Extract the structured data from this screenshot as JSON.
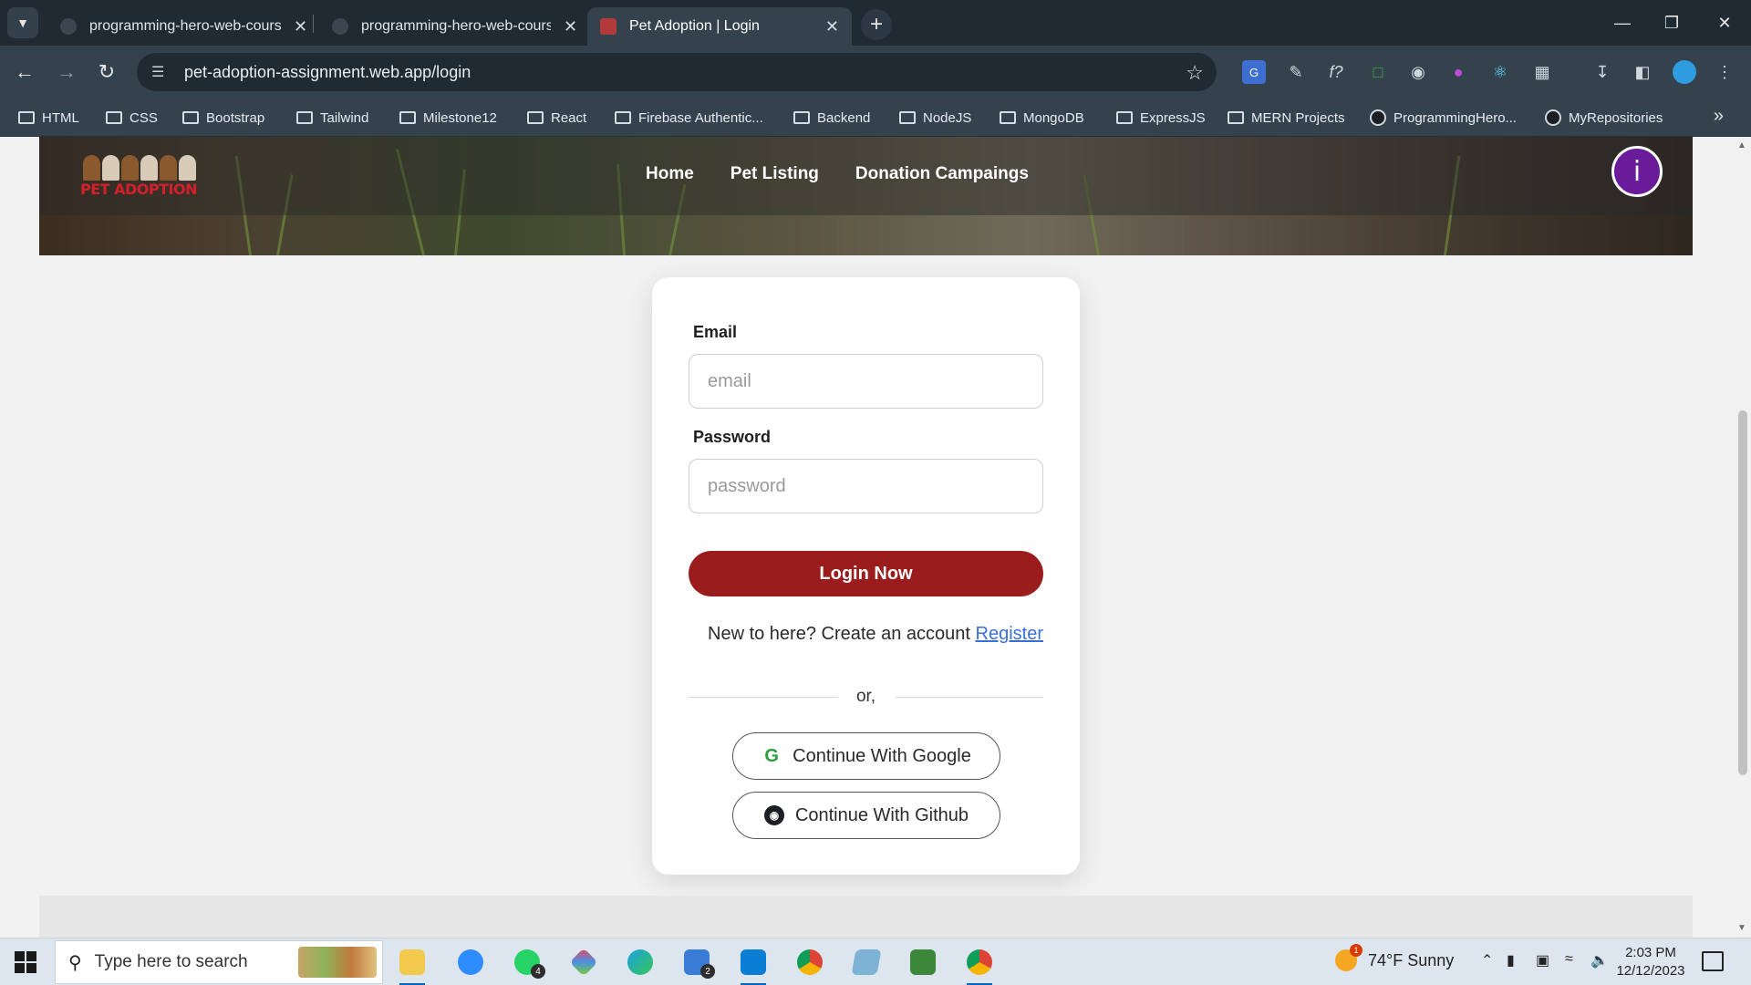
{
  "browser": {
    "tabs": [
      {
        "title": "programming-hero-web-course",
        "active": false
      },
      {
        "title": "programming-hero-web-course",
        "active": false
      },
      {
        "title": "Pet Adoption | Login",
        "active": true
      }
    ],
    "url": "pet-adoption-assignment.web.app/login",
    "bookmarks": [
      {
        "label": "HTML",
        "type": "folder"
      },
      {
        "label": "CSS",
        "type": "folder"
      },
      {
        "label": "Bootstrap",
        "type": "folder"
      },
      {
        "label": "Tailwind",
        "type": "folder"
      },
      {
        "label": "Milestone12",
        "type": "folder"
      },
      {
        "label": "React",
        "type": "folder"
      },
      {
        "label": "Firebase Authentic...",
        "type": "folder"
      },
      {
        "label": "Backend",
        "type": "folder"
      },
      {
        "label": "NodeJS",
        "type": "folder"
      },
      {
        "label": "MongoDB",
        "type": "folder"
      },
      {
        "label": "ExpressJS",
        "type": "folder"
      },
      {
        "label": "MERN Projects",
        "type": "folder"
      },
      {
        "label": "ProgrammingHero...",
        "type": "github"
      },
      {
        "label": "MyRepositories",
        "type": "github"
      }
    ]
  },
  "site": {
    "logo_text": "PET ADOPTION",
    "nav": [
      "Home",
      "Pet Listing",
      "Donation Campaings"
    ],
    "avatar_letter": "i"
  },
  "login": {
    "email_label": "Email",
    "email_placeholder": "email",
    "password_label": "Password",
    "password_placeholder": "password",
    "submit_label": "Login Now",
    "register_prompt": "New to here? Create an account",
    "register_link": "Register",
    "divider_text": "or,",
    "google_label": "Continue With Google",
    "github_label": "Continue With Github"
  },
  "taskbar": {
    "search_placeholder": "Type here to search",
    "whatsapp_badge": "4",
    "mail_badge": "2",
    "weather_badge": "1",
    "weather": "74°F  Sunny",
    "time": "2:03 PM",
    "date": "12/12/2023"
  },
  "colors": {
    "primary": "#9b1c1c",
    "link": "#3b6fd8",
    "avatar": "#6a1b9a",
    "chrome_dark": "#1f2a33",
    "chrome": "#34424e"
  }
}
